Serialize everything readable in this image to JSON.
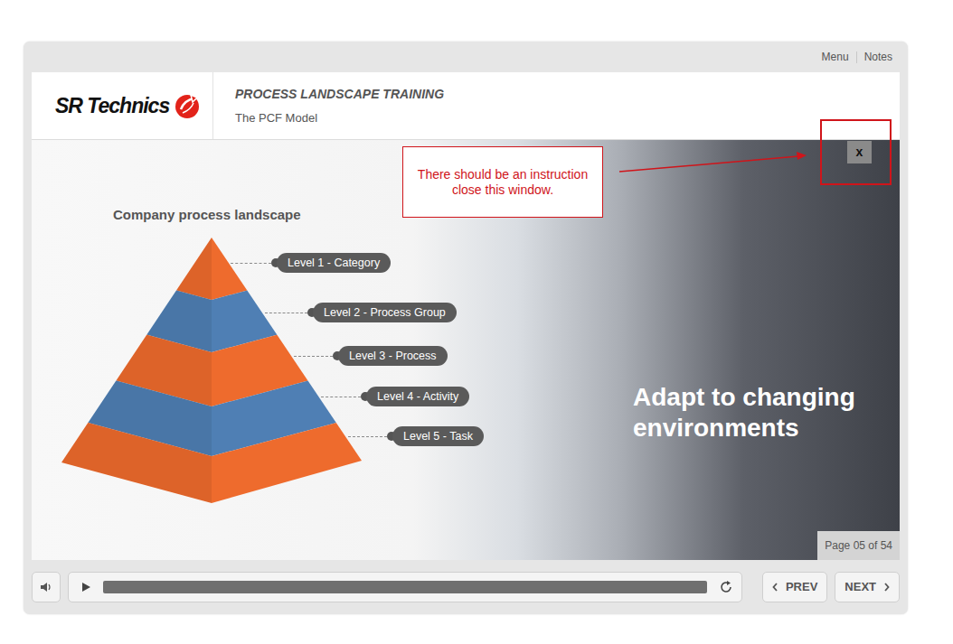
{
  "top_links": [
    {
      "label": "Menu"
    },
    {
      "label": "Notes"
    }
  ],
  "header": {
    "logo": "SR Technics",
    "title": "PROCESS LANDSCAPE TRAINING",
    "subtitle": "The PCF Model"
  },
  "slide": {
    "diagram_title": "Company process landscape",
    "levels": [
      {
        "label": "Level 1 - Category",
        "color": "#ee6b2d"
      },
      {
        "label": "Level 2 - Process Group",
        "color": "#4f7fb4"
      },
      {
        "label": "Level 3 - Process",
        "color": "#ee6b2d"
      },
      {
        "label": "Level 4 - Activity",
        "color": "#4f7fb4"
      },
      {
        "label": "Level 5 - Task",
        "color": "#ee6b2d"
      }
    ],
    "headline": "Adapt to changing environments",
    "close": "x",
    "page": "Page 05 of 54"
  },
  "annotation": {
    "text": "There should be an instruction close this window."
  },
  "controls": {
    "progress": {
      "level": 1
    },
    "prev": "PREV",
    "next": "NEXT"
  }
}
